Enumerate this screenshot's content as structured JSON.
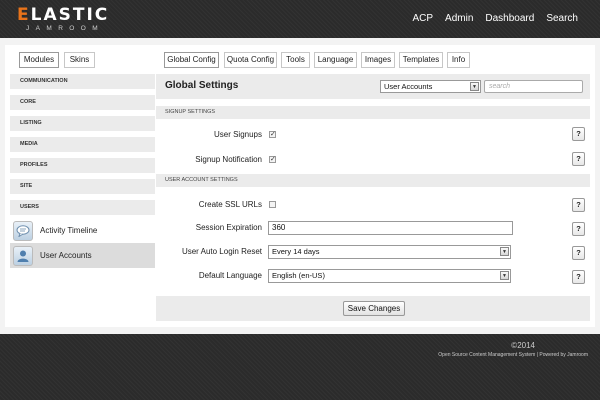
{
  "header": {
    "logo_main_first": "E",
    "logo_main_rest": "LASTIC",
    "logo_sub": "JAMROOM",
    "nav": [
      "ACP",
      "Admin",
      "Dashboard",
      "Search"
    ]
  },
  "left_tabs": [
    "Modules",
    "Skins"
  ],
  "right_tabs": [
    "Global Config",
    "Quota Config",
    "Tools",
    "Language",
    "Images",
    "Templates",
    "Info"
  ],
  "active_left_tab": "Modules",
  "active_right_tab": "Global Config",
  "sidebar": {
    "categories": [
      "COMMUNICATION",
      "CORE",
      "LISTING",
      "MEDIA",
      "PROFILES",
      "SITE",
      "USERS"
    ],
    "items": [
      {
        "label": "Activity Timeline",
        "icon": "chat-bubble-icon",
        "active": false
      },
      {
        "label": "User Accounts",
        "icon": "user-icon",
        "active": true
      }
    ]
  },
  "content": {
    "title": "Global Settings",
    "module_select": "User Accounts",
    "search_placeholder": "search",
    "sections": [
      "SIGNUP SETTINGS",
      "USER ACCOUNT SETTINGS"
    ],
    "signup": {
      "signups_label": "User Signups",
      "signups_checked": true,
      "notification_label": "Signup Notification",
      "notification_checked": true
    },
    "account": {
      "ssl_label": "Create SSL URLs",
      "ssl_checked": false,
      "session_label": "Session Expiration",
      "session_value": "360",
      "login_reset_label": "User Auto Login Reset",
      "login_reset_value": "Every 14 days",
      "language_label": "Default Language",
      "language_value": "English (en-US)"
    },
    "help_label": "?",
    "save_label": "Save Changes"
  },
  "footer": {
    "copyright": "©2014",
    "powered": "Open Source Content Management System | Powered by Jamroom"
  },
  "colors": {
    "header_bg": "#2b2b2b",
    "logo_accent": "#e8731a",
    "panel_bg": "#ffffff",
    "bar_bg": "#ebebeb"
  }
}
